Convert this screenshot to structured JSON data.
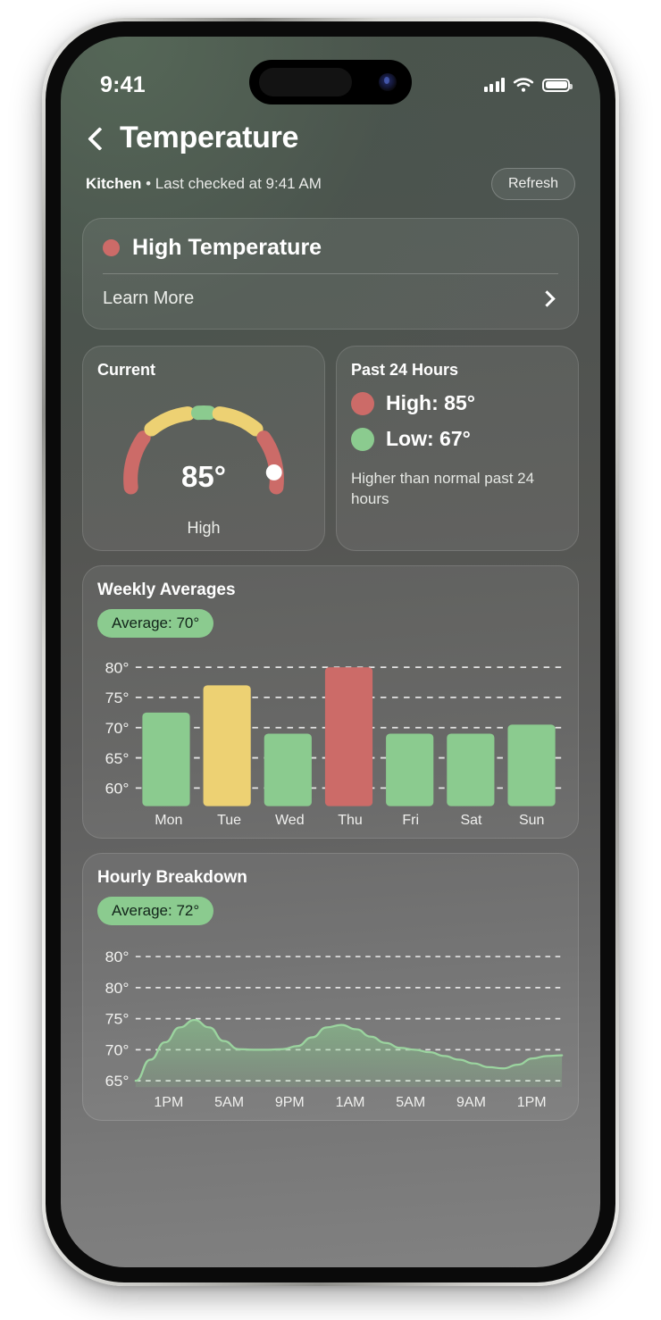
{
  "status_bar": {
    "time": "9:41",
    "signal_icon": "cellular-bars-icon",
    "wifi_icon": "wifi-icon",
    "battery_icon": "battery-full-icon"
  },
  "nav": {
    "back_icon": "chevron-left-icon",
    "title": "Temperature"
  },
  "subbar": {
    "room": "Kitchen",
    "separator": " • ",
    "status": "Last checked at 9:41 AM",
    "refresh_label": "Refresh"
  },
  "alert": {
    "dot_icon": "status-dot-icon",
    "title": "High Temperature",
    "link_label": "Learn More",
    "chevron_icon": "chevron-right-icon"
  },
  "current": {
    "label": "Current",
    "value": "85°",
    "status": "High",
    "indicator_icon": "gauge-indicator-dot"
  },
  "past24": {
    "label": "Past 24 Hours",
    "high_label": "High: 85°",
    "low_label": "Low: 67°",
    "high_dot_icon": "high-dot-icon",
    "low_dot_icon": "low-dot-icon",
    "note": "Higher than normal past 24 hours"
  },
  "weekly": {
    "title": "Weekly Averages",
    "average_label": "Average: 70°"
  },
  "hourly": {
    "title": "Hourly Breakdown",
    "average_label": "Average: 72°"
  },
  "colors": {
    "red": "#CC6B68",
    "yellow": "#EDD173",
    "green": "#8BCB8F",
    "pill_green": "#8BCB8F",
    "text_white": "#FFFFFF"
  },
  "chart_data": [
    {
      "type": "bar",
      "title": "Weekly Averages",
      "categories": [
        "Mon",
        "Tue",
        "Wed",
        "Thu",
        "Fri",
        "Sat",
        "Sun"
      ],
      "values": [
        72.5,
        77,
        69,
        80,
        69,
        69,
        70.5
      ],
      "colors": [
        "#8BCB8F",
        "#EDD173",
        "#8BCB8F",
        "#CC6B68",
        "#8BCB8F",
        "#8BCB8F",
        "#8BCB8F"
      ],
      "ytick_labels": [
        "80°",
        "75°",
        "70°",
        "65°",
        "60°"
      ],
      "yticks": [
        80,
        75,
        70,
        65,
        60
      ],
      "ylim": [
        57,
        82
      ],
      "xlabel": "",
      "ylabel": "",
      "grid": true,
      "legend": "none",
      "annotation": "Average: 70°"
    },
    {
      "type": "area",
      "title": "Hourly Breakdown",
      "x": [
        "1PM",
        "5AM",
        "9PM",
        "1AM",
        "5AM",
        "9AM",
        "1PM"
      ],
      "ytick_labels": [
        "80°",
        "80°",
        "75°",
        "70°",
        "65°"
      ],
      "yticks": [
        85,
        80,
        75,
        70,
        65
      ],
      "ylim": [
        64,
        87
      ],
      "values": [
        65,
        68.4,
        71.2,
        73.6,
        74.8,
        73.6,
        71.4,
        70.1,
        70.0,
        70.0,
        70.1,
        70.6,
        72.0,
        73.6,
        74.0,
        73.3,
        72.1,
        71.1,
        70.3,
        70.0,
        69.6,
        69.0,
        68.4,
        67.8,
        67.2,
        67.0,
        67.6,
        68.6,
        69.0,
        69.1
      ],
      "xlabel": "",
      "ylabel": "",
      "grid": true,
      "legend": "none",
      "annotation": "Average: 72°"
    }
  ]
}
